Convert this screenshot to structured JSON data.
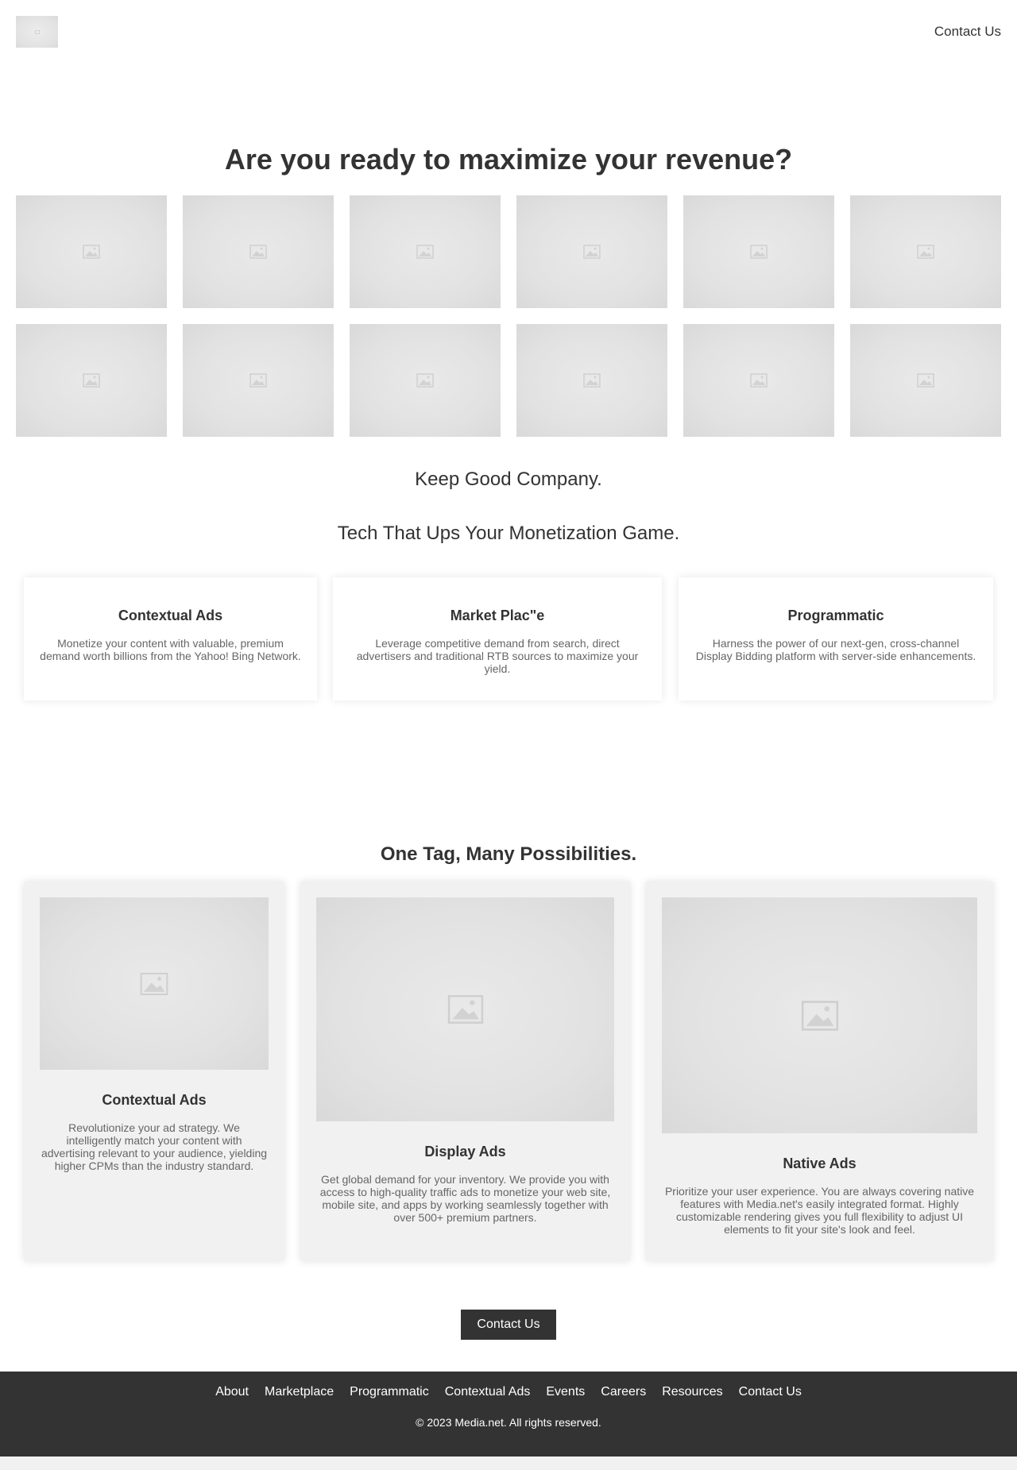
{
  "header": {
    "logo_icon": "image-placeholder-icon",
    "contact_label": "Contact Us"
  },
  "hero": {
    "title": "Are you ready to maximize your revenue?",
    "partner_logos": [
      "image-placeholder-icon",
      "image-placeholder-icon",
      "image-placeholder-icon",
      "image-placeholder-icon",
      "image-placeholder-icon",
      "image-placeholder-icon",
      "image-placeholder-icon",
      "image-placeholder-icon",
      "image-placeholder-icon",
      "image-placeholder-icon",
      "image-placeholder-icon",
      "image-placeholder-icon"
    ]
  },
  "taglines": {
    "company": "Keep Good Company.",
    "tech": "Tech That Ups Your Monetization Game."
  },
  "features": [
    {
      "title": "Contextual Ads",
      "text": "Monetize your content with valuable, premium demand worth billions from the Yahoo! Bing Network."
    },
    {
      "title": "Market Plac\"e",
      "text": "Leverage competitive demand from search, direct advertisers and traditional RTB sources to maximize your yield."
    },
    {
      "title": "Programmatic",
      "text": "Harness the power of our next-gen, cross-channel Display Bidding platform with server-side enhancements."
    }
  ],
  "one_tag": {
    "title": "One Tag, Many Possibilities.",
    "cards": [
      {
        "title": "Contextual Ads",
        "text": "Revolutionize your ad strategy. We intelligently match your content with advertising relevant to your audience, yielding higher CPMs than the industry standard."
      },
      {
        "title": "Display Ads",
        "text": "Get global demand for your inventory. We provide you with access to high-quality traffic ads to monetize your web site, mobile site, and apps by working seamlessly together with over 500+ premium partners."
      },
      {
        "title": "Native Ads",
        "text": "Prioritize your user experience. You are always covering native features with Media.net's easily integrated format. Highly customizable rendering gives you full flexibility to adjust UI elements to fit your site's look and feel."
      }
    ]
  },
  "cta": {
    "label": "Contact Us"
  },
  "footer": {
    "nav": [
      "About",
      "Marketplace",
      "Programmatic",
      "Contextual Ads",
      "Events",
      "Careers",
      "Resources",
      "Contact Us"
    ],
    "copyright": "© 2023 Media.net. All rights reserved."
  },
  "colors": {
    "text": "#333333",
    "muted_text": "#666666",
    "footer_bg": "#333333",
    "placeholder": "#e2e2e2",
    "card_bg": "#f1f1f1"
  }
}
